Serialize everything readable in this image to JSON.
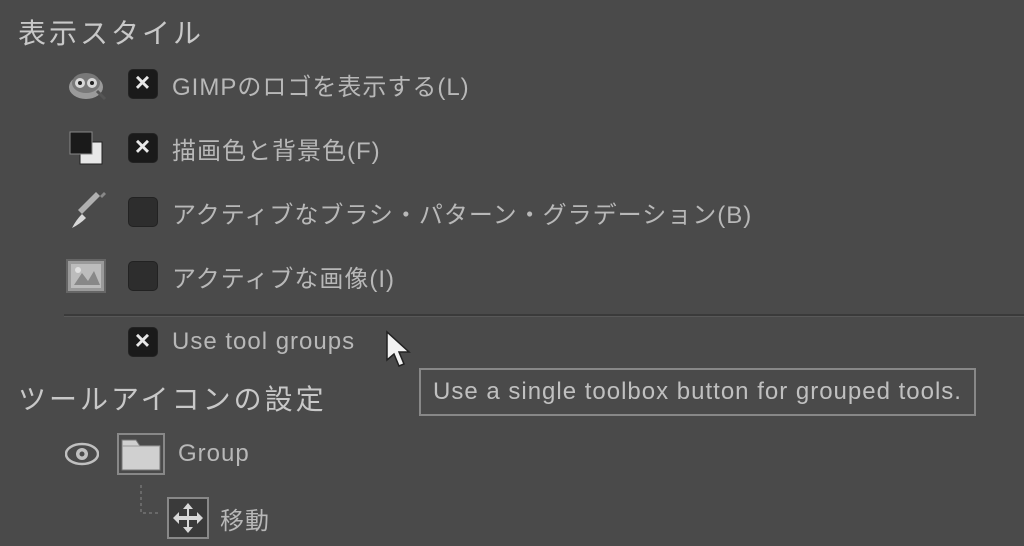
{
  "sections": {
    "display_style_heading": "表示スタイル",
    "tool_icon_heading": "ツールアイコンの設定"
  },
  "options": {
    "show_gimp_logo": {
      "label": "GIMPのロゴを表示する(L)",
      "checked": true
    },
    "fg_bg_color": {
      "label": "描画色と背景色(F)",
      "checked": true
    },
    "active_brush_pattern_gradient": {
      "label": "アクティブなブラシ・パターン・グラデーション(B)",
      "checked": false
    },
    "active_image": {
      "label": "アクティブな画像(I)",
      "checked": false
    },
    "use_tool_groups": {
      "label": "Use tool groups",
      "checked": true
    }
  },
  "tooltip": {
    "use_tool_groups": "Use a single toolbox button for grouped tools."
  },
  "tree": {
    "group_label": "Group",
    "move_label": "移動"
  }
}
